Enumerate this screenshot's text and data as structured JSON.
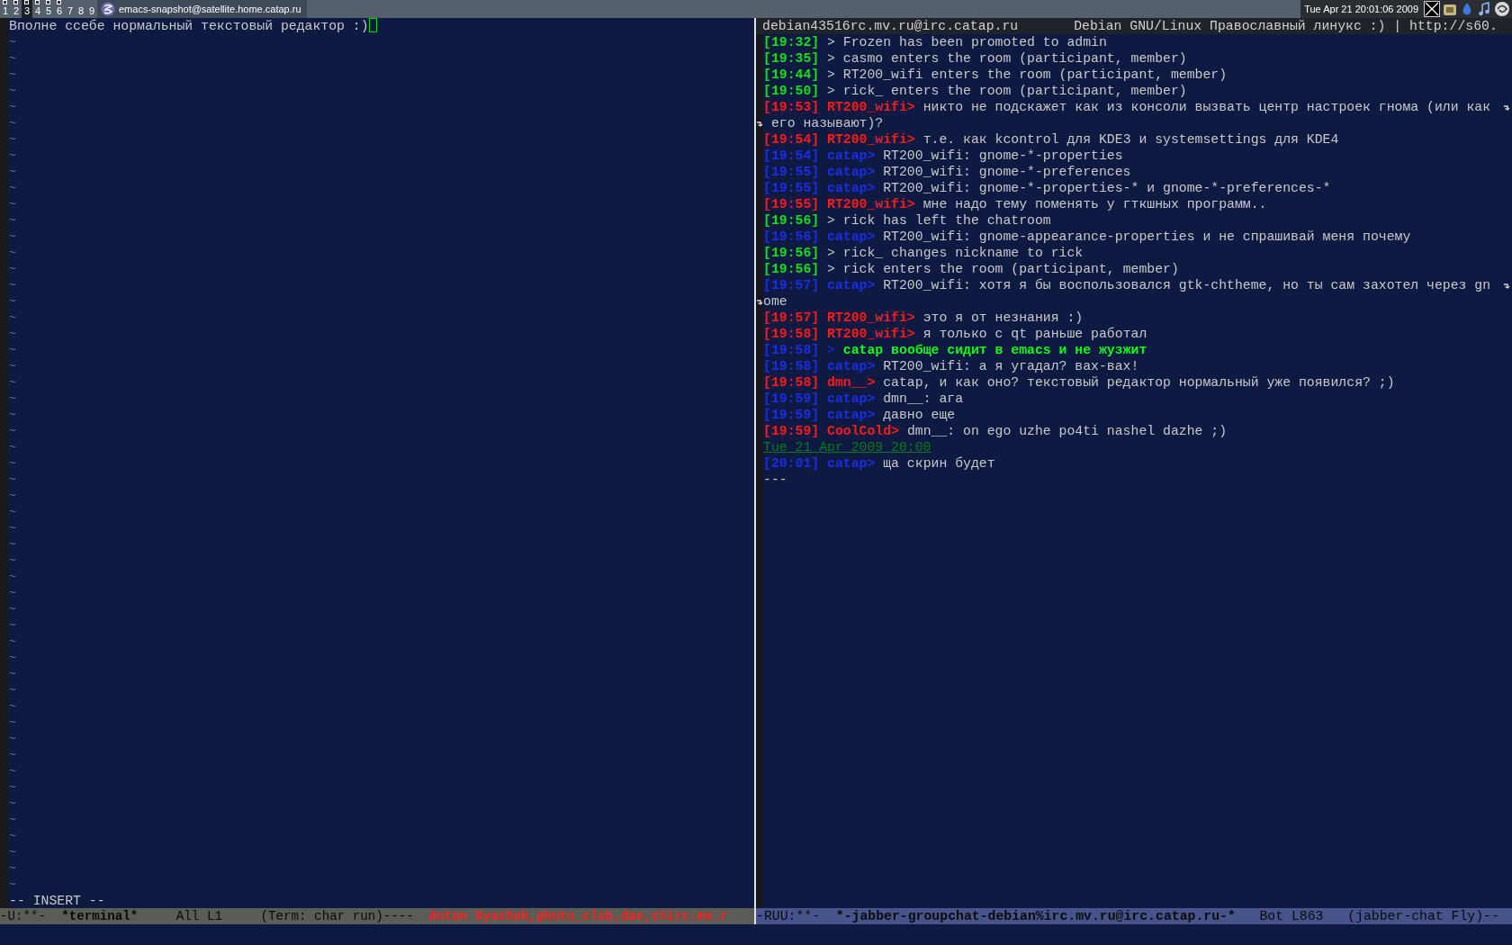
{
  "panel": {
    "desktops": [
      {
        "label": "1",
        "selected": false,
        "has_windows": true
      },
      {
        "label": "2",
        "selected": false,
        "has_windows": true
      },
      {
        "label": "3",
        "selected": true,
        "has_windows": true
      },
      {
        "label": "4",
        "selected": false,
        "has_windows": true
      },
      {
        "label": "5",
        "selected": false,
        "has_windows": true
      },
      {
        "label": "6",
        "selected": false,
        "has_windows": true
      },
      {
        "label": "7",
        "selected": false,
        "has_windows": false
      },
      {
        "label": "8",
        "selected": false,
        "has_windows": false
      },
      {
        "label": "9",
        "selected": false,
        "has_windows": false
      }
    ],
    "window_title": "emacs-snapshot@satellite.home.catap.ru",
    "clock": "Tue Apr 21 20:01:06 2009"
  },
  "left_pane": {
    "first_line": "Вполне ссебе нормальный текстовый редактор :)",
    "empty_line_count_rows": [
      "~",
      "~",
      "~",
      "~",
      "~",
      "~",
      "~",
      "~",
      "~",
      "~",
      "~",
      "~",
      "~",
      "~",
      "~",
      "~",
      "~",
      "~",
      "~",
      "~",
      "~",
      "~",
      "~",
      "~",
      "~",
      "~",
      "~",
      "~",
      "~",
      "~",
      "~",
      "~",
      "~",
      "~",
      "~",
      "~",
      "~",
      "~",
      "~",
      "~",
      "~",
      "~",
      "~",
      "~",
      "~",
      "~",
      "~",
      "~",
      "~",
      "~",
      "~",
      "~",
      "~"
    ],
    "status_line": "-- INSERT --",
    "mode_line": {
      "flags": "-U:**-",
      "buffer": "*terminal*",
      "position": "All L1",
      "mode": "(Term: char run)----",
      "alerts": "Anton Dyachuk,photo_club,dao,c%irc.mv.r"
    }
  },
  "right_pane": {
    "header_room": "debian43516rc.mv.ru@irc.catap.ru",
    "header_topic": "Debian GNU/Linux Православный линукс :) | http://s60.",
    "messages": [
      {
        "kind": "system",
        "time": "[19:32]",
        "nick": ">",
        "text": "Frozen has been promoted to admin"
      },
      {
        "kind": "system",
        "time": "[19:35]",
        "nick": ">",
        "text": "casmo enters the room (participant, member)"
      },
      {
        "kind": "system",
        "time": "[19:44]",
        "nick": ">",
        "text": "RT200_wifi enters the room (participant, member)"
      },
      {
        "kind": "system",
        "time": "[19:50]",
        "nick": ">",
        "text": "rick_ enters the room (participant, member)"
      },
      {
        "kind": "other",
        "time": "[19:53]",
        "nick": "RT200_wifi>",
        "text": "никто не подскажет как из консоли вызвать центр настроек гнома (или как",
        "continuation": "его называют)?"
      },
      {
        "kind": "other",
        "time": "[19:54]",
        "nick": "RT200_wifi>",
        "text": "т.е. как kcontrol для KDE3 и systemsettings для KDE4"
      },
      {
        "kind": "self",
        "time": "[19:54]",
        "nick": "catap>",
        "text": "RT200_wifi: gnome-*-properties"
      },
      {
        "kind": "self",
        "time": "[19:55]",
        "nick": "catap>",
        "text": "RT200_wifi: gnome-*-preferences"
      },
      {
        "kind": "self",
        "time": "[19:55]",
        "nick": "catap>",
        "text": "RT200_wifi: gnome-*-properties-* и gnome-*-preferences-*"
      },
      {
        "kind": "other",
        "time": "[19:55]",
        "nick": "RT200_wifi>",
        "text": "мне надо тему поменять у гткшных программ.."
      },
      {
        "kind": "system",
        "time": "[19:56]",
        "nick": ">",
        "text": "rick has left the chatroom"
      },
      {
        "kind": "self",
        "time": "[19:56]",
        "nick": "catap>",
        "text": "RT200_wifi: gnome-appearance-properties и не спрашивай меня почему"
      },
      {
        "kind": "system",
        "time": "[19:56]",
        "nick": ">",
        "text": "rick_ changes nickname to rick"
      },
      {
        "kind": "system",
        "time": "[19:56]",
        "nick": ">",
        "text": "rick enters the room (participant, member)"
      },
      {
        "kind": "self",
        "time": "[19:57]",
        "nick": "catap>",
        "text": "RT200_wifi: хотя я бы воспользовался gtk-chtheme, но ты сам захотел через gn",
        "continuation": "ome"
      },
      {
        "kind": "other",
        "time": "[19:57]",
        "nick": "RT200_wifi>",
        "text": "это я от незнания :)"
      },
      {
        "kind": "other",
        "time": "[19:58]",
        "nick": "RT200_wifi>",
        "text": "я только с qt раньше работал"
      },
      {
        "kind": "self_action",
        "time": "[19:58]",
        "nick": ">",
        "text": "catap вообще сидит в emacs и не жузжит"
      },
      {
        "kind": "self",
        "time": "[19:58]",
        "nick": "catap>",
        "text": "RT200_wifi: а я угадал? вах-вах!"
      },
      {
        "kind": "other",
        "time": "[19:58]",
        "nick": "dmn__>",
        "text": "catap, и как оно? текстовый редактор нормальный уже появился? ;)"
      },
      {
        "kind": "self",
        "time": "[19:59]",
        "nick": "catap>",
        "text": "dmn__: ага"
      },
      {
        "kind": "self",
        "time": "[19:59]",
        "nick": "catap>",
        "text": "давно еще"
      },
      {
        "kind": "other",
        "time": "[19:59]",
        "nick": "CoolCold>",
        "text": "dmn__: on ego uzhe po4ti nashel dazhe ;)"
      },
      {
        "kind": "date",
        "text": "Tue 21 Apr 2009 20:00"
      },
      {
        "kind": "self",
        "time": "[20:01]",
        "nick": "catap>",
        "text": "ща скрин будет"
      },
      {
        "kind": "plain",
        "text": "---"
      }
    ],
    "mode_line": {
      "flags": "-RUU:**-",
      "buffer": "*-jabber-groupchat-debian%irc.mv.ru@irc.catap.ru-*",
      "position": "Bot L863",
      "mode": "(jabber-chat Fly)--"
    }
  }
}
